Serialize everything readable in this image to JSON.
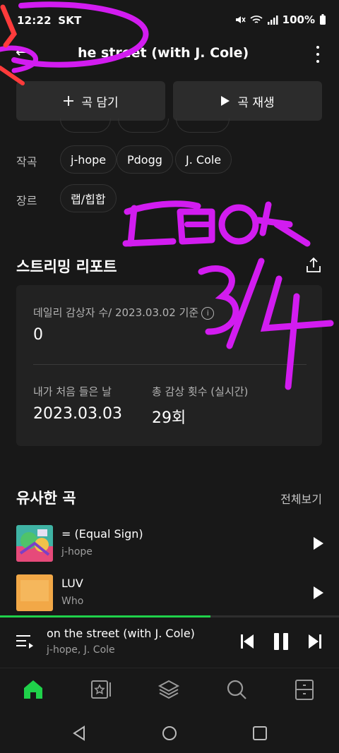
{
  "status_bar": {
    "time": "12:22",
    "carrier": "SKT",
    "battery": "100%"
  },
  "header": {
    "title": "on the street (with J. Cole)",
    "title_visible_part": "he street (with J. Cole)"
  },
  "actions": {
    "add_label": "곡 담기",
    "play_label": "곡 재생"
  },
  "credits": {
    "composer_label": "작곡",
    "composers": [
      "j-hope",
      "Pdogg",
      "J. Cole"
    ],
    "genre_label": "장르",
    "genres": [
      "랩/힙합"
    ]
  },
  "report": {
    "title": "스트리밍 리포트",
    "daily_label": "데일리 감상자 수/ 2023.03.02 기준",
    "daily_value": "0",
    "first_listen_label": "내가 처음 들은 날",
    "first_listen_value": "2023.03.03",
    "total_plays_label": "총 감상 횟수 (실시간)",
    "total_plays_value": "29회"
  },
  "similar": {
    "title": "유사한 곡",
    "see_all": "전체보기",
    "songs": [
      {
        "title": "= (Equal Sign)",
        "artist": "j-hope"
      },
      {
        "title": "LUV",
        "artist": "Who"
      }
    ]
  },
  "mini_player": {
    "title": "on the street (with J. Cole)",
    "artist": "j-hope, J. Cole",
    "progress": 0.62
  },
  "colors": {
    "accent": "#1fd14a",
    "scribble_magenta": "#d21cf0",
    "scribble_red": "#ff3b3b"
  },
  "bottom_nav": [
    "home-icon",
    "storage-icon",
    "library-icon",
    "search-icon",
    "locker-icon"
  ]
}
